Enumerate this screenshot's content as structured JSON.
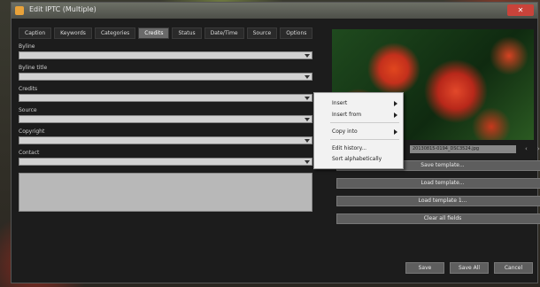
{
  "window": {
    "title": "Edit IPTC (Multiple)",
    "close_label": "✕"
  },
  "tabs": [
    "Caption",
    "Keywords",
    "Categories",
    "Credits",
    "Status",
    "Date/Time",
    "Source",
    "Options"
  ],
  "active_tab": "Credits",
  "fields": [
    {
      "label": "Byline"
    },
    {
      "label": "Byline title"
    },
    {
      "label": "Credits"
    },
    {
      "label": "Source"
    },
    {
      "label": "Copyright"
    },
    {
      "label": "Contact"
    }
  ],
  "preview": {
    "filename": "20130815-0194_DSC3524.jpg",
    "prev_icon": "‹",
    "next_icon": "›"
  },
  "template_buttons": [
    "Save template...",
    "Load template...",
    "Load template 1...",
    "Clear all fields"
  ],
  "bottom_buttons": [
    "Save",
    "Save All",
    "Cancel"
  ],
  "context_menu": {
    "items": [
      {
        "label": "Insert",
        "submenu": true
      },
      {
        "label": "Insert from",
        "submenu": true
      },
      {
        "label": "Copy into",
        "submenu": true
      },
      {
        "label": "Edit history...",
        "submenu": false
      },
      {
        "label": "Sort alphabetically",
        "submenu": false
      }
    ]
  },
  "colors": {
    "window_bg": "#1c1c1c",
    "active_tab": "#6a6a6a",
    "input_bg": "#d2d2d2",
    "button_bg": "#5e5e5e"
  }
}
